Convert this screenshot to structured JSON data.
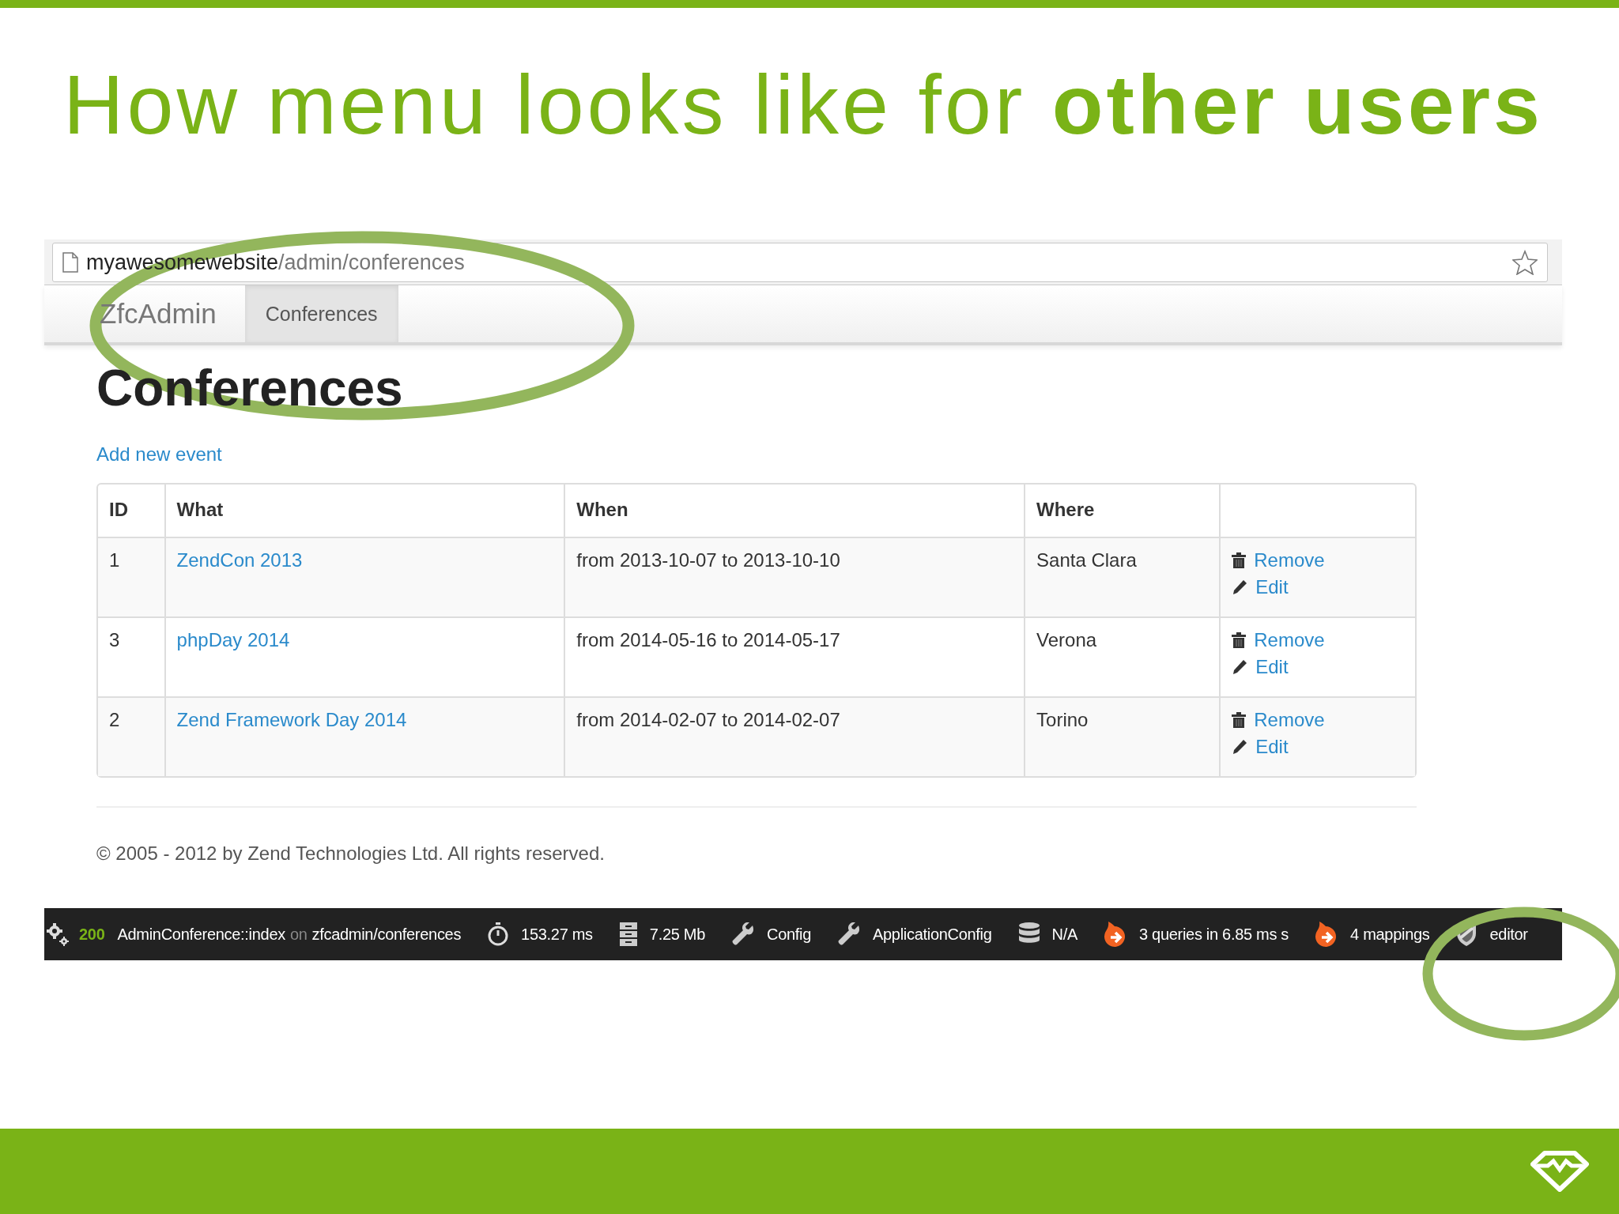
{
  "slide_title": "How menu looks like for **other users**",
  "browser": {
    "url_host": "myawesomewebsite",
    "url_path": "/admin/conferences"
  },
  "navbar": {
    "brand": "ZfcAdmin",
    "items": [
      {
        "label": "Conferences",
        "selected": true
      }
    ]
  },
  "page": {
    "heading": "Conferences",
    "add_link": "Add new event",
    "table": {
      "columns": [
        "ID",
        "What",
        "When",
        "Where"
      ],
      "rows": [
        {
          "id": "1",
          "what": "ZendCon 2013",
          "when": "from 2013-10-07 to 2013-10-10",
          "where": "Santa Clara",
          "actions": [
            {
              "kind": "remove",
              "label": "Remove"
            },
            {
              "kind": "edit",
              "label": "Edit"
            }
          ]
        },
        {
          "id": "3",
          "what": "phpDay 2014",
          "when": "from 2014-05-16 to 2014-05-17",
          "where": "Verona",
          "actions": [
            {
              "kind": "remove",
              "label": "Remove"
            },
            {
              "kind": "edit",
              "label": "Edit"
            }
          ]
        },
        {
          "id": "2",
          "what": "Zend Framework Day 2014",
          "when": "from 2014-02-07 to 2014-02-07",
          "where": "Torino",
          "actions": [
            {
              "kind": "remove",
              "label": "Remove"
            },
            {
              "kind": "edit",
              "label": "Edit"
            }
          ]
        }
      ]
    },
    "footer": "© 2005 - 2012 by Zend Technologies Ltd. All rights reserved."
  },
  "toolbar": {
    "status": {
      "code": "200",
      "route": "AdminConference::index",
      "on": "on",
      "path": "zfcadmin/conferences"
    },
    "items": [
      {
        "kind": "time",
        "label": "153.27 ms"
      },
      {
        "kind": "memory",
        "label": "7.25 Mb"
      },
      {
        "kind": "config",
        "label": "Config"
      },
      {
        "kind": "config",
        "label": "ApplicationConfig"
      },
      {
        "kind": "database",
        "label": "N/A"
      },
      {
        "kind": "doctrine",
        "label": "3 queries in 6.85 ms s"
      },
      {
        "kind": "doctrine",
        "label": "4 mappings"
      },
      {
        "kind": "identity",
        "label": "editor"
      }
    ]
  }
}
